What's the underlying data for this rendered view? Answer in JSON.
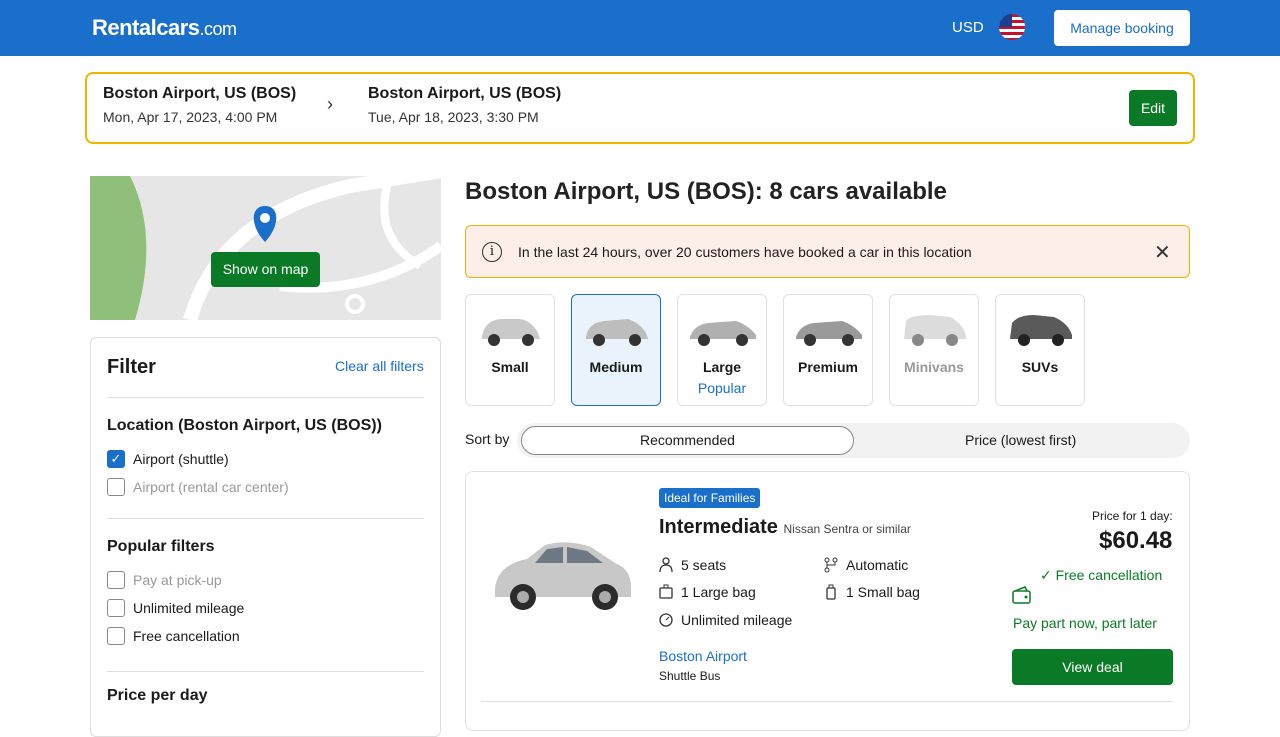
{
  "header": {
    "logo_main": "Rentalcars",
    "logo_suffix": ".com",
    "currency": "USD",
    "manage_booking": "Manage booking"
  },
  "search": {
    "pickup_location": "Boston Airport, US (BOS)",
    "pickup_datetime": "Mon, Apr 17, 2023, 4:00 PM",
    "dropoff_location": "Boston Airport, US (BOS)",
    "dropoff_datetime": "Tue, Apr 18, 2023, 3:30 PM",
    "edit": "Edit"
  },
  "map": {
    "show_on_map": "Show on map"
  },
  "filters": {
    "title": "Filter",
    "clear_all": "Clear all filters",
    "location_heading": "Location (Boston Airport, US (BOS))",
    "location_options": [
      {
        "label": "Airport (shuttle)",
        "checked": true
      },
      {
        "label": "Airport (rental car center)",
        "checked": false
      }
    ],
    "popular_heading": "Popular filters",
    "popular_options": [
      {
        "label": "Pay at pick-up"
      },
      {
        "label": "Unlimited mileage"
      },
      {
        "label": "Free cancellation"
      }
    ],
    "price_heading": "Price per day"
  },
  "results": {
    "title": "Boston Airport, US (BOS): 8 cars available",
    "alert": "In the last 24 hours, over 20 customers have booked a car in this location",
    "categories": [
      {
        "label": "Small"
      },
      {
        "label": "Medium"
      },
      {
        "label": "Large",
        "sub": "Popular"
      },
      {
        "label": "Premium"
      },
      {
        "label": "Minivans"
      },
      {
        "label": "SUVs"
      }
    ],
    "sort_label": "Sort by",
    "sort_options": [
      "Recommended",
      "Price (lowest first)"
    ]
  },
  "car": {
    "badge": "Ideal for Families",
    "class": "Intermediate",
    "similar": "Nissan Sentra or similar",
    "seats": "5 seats",
    "transmission": "Automatic",
    "large_bag": "1 Large bag",
    "small_bag": "1 Small bag",
    "mileage": "Unlimited mileage",
    "location": "Boston Airport",
    "location_type": "Shuttle Bus",
    "price_for": "Price for 1 day:",
    "price": "$60.48",
    "free_cancellation": "Free cancellation",
    "pay_part": "Pay part now, part later",
    "view_deal": "View deal"
  },
  "colors": {
    "brand": "#1a6fca",
    "cta": "#0b7a26",
    "accent": "#f0b400"
  }
}
